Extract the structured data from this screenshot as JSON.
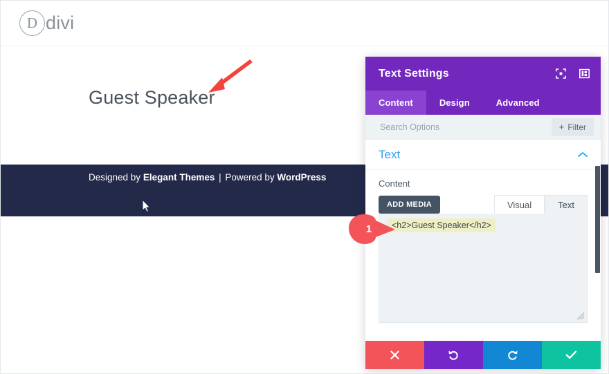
{
  "site": {
    "logo_letter": "D",
    "logo_text": "divi",
    "heading": "Guest Speaker",
    "footer": {
      "designed_by": "Designed by ",
      "designer": "Elegant Themes",
      "separator": " | ",
      "powered_by": "Powered by ",
      "platform": "WordPress"
    }
  },
  "annotation": {
    "badge_number": "1",
    "badge_color": "#f3545a",
    "arrow_color": "#f4423c"
  },
  "panel": {
    "title": "Text Settings",
    "header_color": "#7227bd",
    "icons": {
      "focus": "focus-target-icon",
      "layout": "panel-layout-icon"
    },
    "tabs": [
      {
        "label": "Content",
        "active": true
      },
      {
        "label": "Design",
        "active": false
      },
      {
        "label": "Advanced",
        "active": false
      }
    ],
    "search": {
      "placeholder": "Search Options",
      "value": ""
    },
    "filter_button": {
      "plus": "+",
      "label": "Filter"
    },
    "section": {
      "title": "Text",
      "collapse_icon": "chevron-up-icon",
      "title_color": "#2ea3f2"
    },
    "content_field": {
      "label": "Content",
      "add_media_label": "ADD MEDIA",
      "editor_tabs": [
        {
          "label": "Visual",
          "active": false
        },
        {
          "label": "Text",
          "active": true
        }
      ],
      "code_value": "<h2>Guest Speaker</h2>",
      "highlight_color": "#efeec4"
    },
    "footer_buttons": [
      {
        "name": "cancel",
        "icon": "close-x-icon",
        "color": "#f3545a"
      },
      {
        "name": "undo",
        "icon": "undo-arrow-icon",
        "color": "#7527c9"
      },
      {
        "name": "redo",
        "icon": "redo-arrow-icon",
        "color": "#1288d4"
      },
      {
        "name": "save",
        "icon": "checkmark-icon",
        "color": "#0ec3a0"
      }
    ]
  }
}
